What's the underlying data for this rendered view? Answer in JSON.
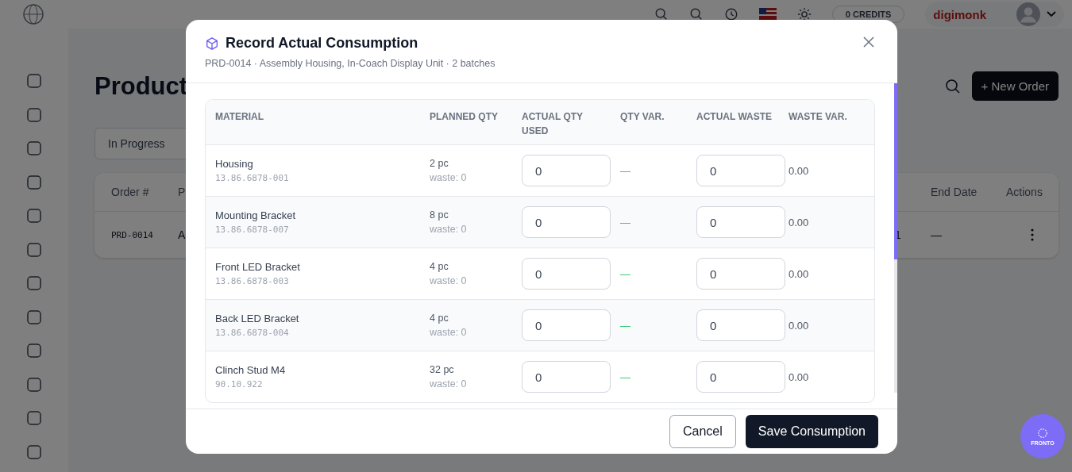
{
  "top_bar": {
    "credits": "0 CREDITS",
    "brand": "digimonk"
  },
  "page": {
    "title": "Product",
    "new_order_button": "+ New Order",
    "filter": "In Progress",
    "table": {
      "columns": [
        "Order #",
        "P",
        "",
        "End Date",
        "Actions"
      ],
      "rows": [
        {
          "order": "PRD-0014",
          "column_2": "A",
          "column_3": "1",
          "end_date": "—"
        }
      ]
    }
  },
  "dialog": {
    "title": "Record Actual Consumption",
    "subtitle": "PRD-0014 · Assembly Housing, In-Coach Display Unit · 2 batches",
    "columns": [
      "MATERIAL",
      "PLANNED QTY",
      "ACTUAL QTY USED",
      "QTY VAR.",
      "ACTUAL WASTE",
      "WASTE VAR."
    ],
    "rows": [
      {
        "name": "Housing",
        "code": "13.86.6878-001",
        "planned": "2 pc",
        "planned_waste": "waste: 0",
        "actual": "0",
        "qty_var": "—",
        "actual_waste": "0",
        "waste_var": "0.00"
      },
      {
        "name": "Mounting Bracket",
        "code": "13.86.6878-007",
        "planned": "8 pc",
        "planned_waste": "waste: 0",
        "actual": "0",
        "qty_var": "—",
        "actual_waste": "0",
        "waste_var": "0.00"
      },
      {
        "name": "Front LED Bracket",
        "code": "13.86.6878-003",
        "planned": "4 pc",
        "planned_waste": "waste: 0",
        "actual": "0",
        "qty_var": "—",
        "actual_waste": "0",
        "waste_var": "0.00"
      },
      {
        "name": "Back LED Bracket",
        "code": "13.86.6878-004",
        "planned": "4 pc",
        "planned_waste": "waste: 0",
        "actual": "0",
        "qty_var": "—",
        "actual_waste": "0",
        "waste_var": "0.00"
      },
      {
        "name": "Clinch Stud M4",
        "code": "90.10.922",
        "planned": "32 pc",
        "planned_waste": "waste: 0",
        "actual": "0",
        "qty_var": "—",
        "actual_waste": "0",
        "waste_var": "0.00"
      }
    ],
    "buttons": {
      "cancel": "Cancel",
      "save": "Save Consumption"
    }
  },
  "assistant_button": {
    "label": "FRONTO"
  }
}
